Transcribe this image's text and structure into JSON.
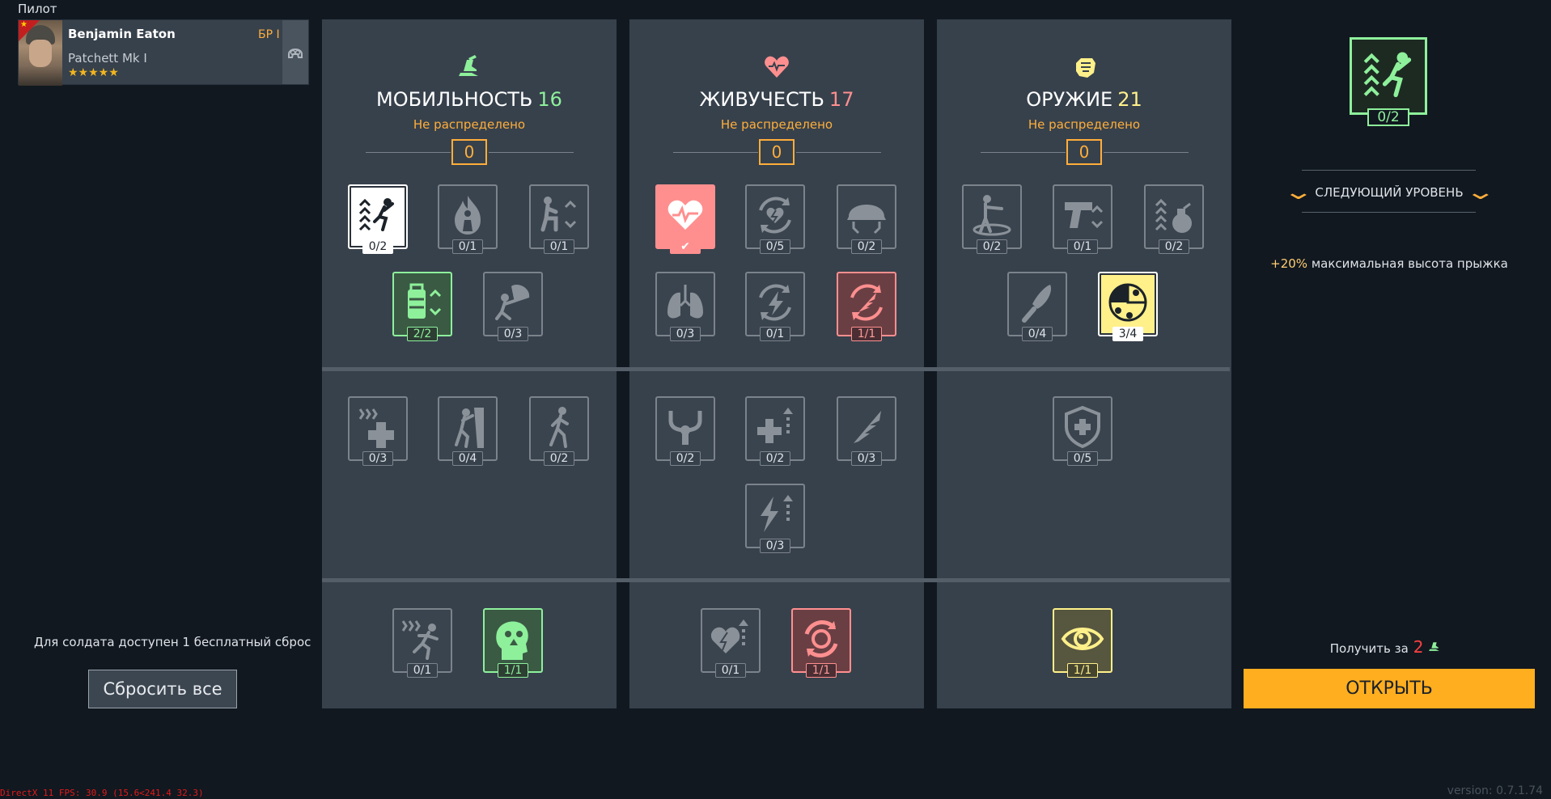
{
  "pilot_label": "Пилот",
  "soldier": {
    "name": "Benjamin Eaton",
    "br": "БР I",
    "vehicle": "Patchett Mk I",
    "stars": "★★★★★"
  },
  "reset": {
    "text": "Для солдата доступен 1 бесплатный сброс",
    "button": "Сбросить все"
  },
  "colors": {
    "green": "#8ef09b",
    "red": "#ff8f8f",
    "yellow": "#fff08a",
    "orange": "#ffae3a"
  },
  "columns": [
    {
      "title": "МОБИЛЬНОСТЬ",
      "points": "16",
      "subtitle": "Не распределено",
      "unassigned": "0",
      "icon": "boot-icon",
      "skills": [
        {
          "icon": "jump-height-icon",
          "count": "0/2"
        },
        {
          "icon": "fire-resistance-icon",
          "count": "0/1"
        },
        {
          "icon": "crouch-speed-icon",
          "count": "0/1"
        },
        {
          "icon": "backpack-capacity-icon",
          "count": "2/2"
        },
        {
          "icon": "parachute-icon",
          "count": "0/3"
        },
        {
          "icon": "heal-speed-icon",
          "count": "0/3"
        },
        {
          "icon": "climb-icon",
          "count": "0/4"
        },
        {
          "icon": "walk-speed-icon",
          "count": "0/2"
        },
        {
          "icon": "sprint-speed-icon",
          "count": "0/1"
        },
        {
          "icon": "stress-resistance-icon",
          "count": "1/1"
        }
      ]
    },
    {
      "title": "ЖИВУЧЕСТЬ",
      "points": "17",
      "subtitle": "Не распределено",
      "unassigned": "0",
      "icon": "heart-icon",
      "skills": [
        {
          "icon": "heart-health-icon",
          "count": ""
        },
        {
          "icon": "stamina-regen-icon",
          "count": "0/5"
        },
        {
          "icon": "helmet-icon",
          "count": "0/2"
        },
        {
          "icon": "lungs-icon",
          "count": "0/3"
        },
        {
          "icon": "energy-regen-icon",
          "count": "0/1"
        },
        {
          "icon": "wing-refresh-icon",
          "count": "1/1"
        },
        {
          "icon": "recoil-control-icon",
          "count": "0/2"
        },
        {
          "icon": "medkit-boost-icon",
          "count": "0/2"
        },
        {
          "icon": "wing-icon",
          "count": "0/3"
        },
        {
          "icon": "energy-boost-icon",
          "count": "0/3"
        },
        {
          "icon": "heart-boost-icon",
          "count": "0/1"
        },
        {
          "icon": "revive-icon",
          "count": "1/1"
        }
      ]
    },
    {
      "title": "ОРУЖИЕ",
      "points": "21",
      "subtitle": "Не распределено",
      "unassigned": "0",
      "icon": "fist-icon",
      "skills": [
        {
          "icon": "aim-move-icon",
          "count": "0/2"
        },
        {
          "icon": "pistol-swap-icon",
          "count": "0/1"
        },
        {
          "icon": "grenade-capacity-icon",
          "count": "0/2"
        },
        {
          "icon": "knife-icon",
          "count": "0/4"
        },
        {
          "icon": "reload-icon",
          "count": "3/4"
        },
        {
          "icon": "armor-shield-icon",
          "count": "0/5"
        },
        {
          "icon": "eye-icon",
          "count": "1/1"
        }
      ]
    }
  ],
  "right": {
    "selected_icon": "jump-height-icon",
    "selected_count": "0/2",
    "next_level": "СЛЕДУЮЩИЙ УРОВЕНЬ",
    "bonus_pct": "+20%",
    "bonus_text": " максимальная высота прыжка",
    "get_for": "Получить за",
    "cost": "2",
    "open_button": "ОТКРЫТЬ"
  },
  "fps": "DirectX 11 FPS: 30.9 (15.6<241.4 32.3)",
  "version": "version: 0.7.1.74"
}
